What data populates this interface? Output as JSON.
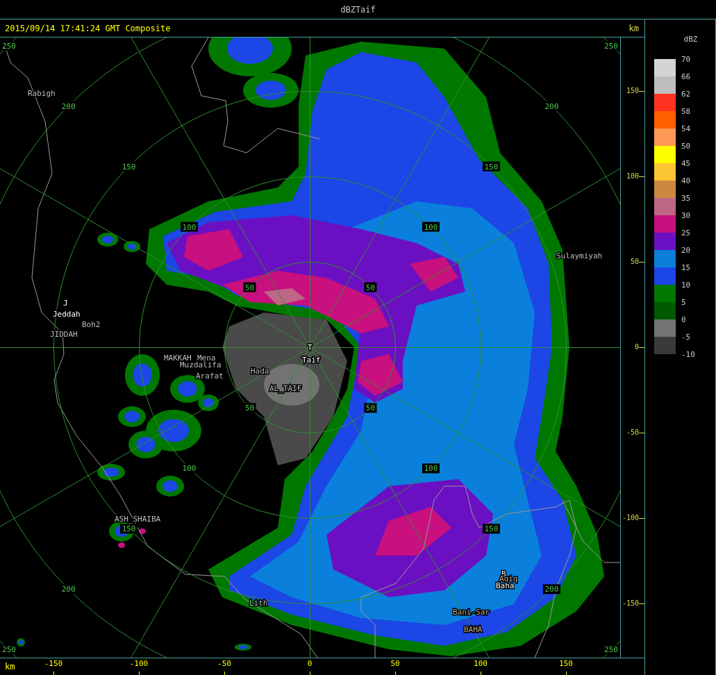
{
  "window": {
    "title": "dBZTaif"
  },
  "header": {
    "timestamp": "2015/09/14 17:41:24 GMT Composite",
    "unit": "km"
  },
  "map": {
    "range_rings": [
      {
        "labels": [
          "50",
          "50",
          "50",
          "50"
        ]
      },
      {
        "labels": [
          "100",
          "100",
          "100",
          "100"
        ]
      },
      {
        "labels": [
          "150",
          "150",
          "150",
          "150"
        ]
      },
      {
        "labels": [
          "200",
          "200",
          "200",
          "200"
        ]
      },
      {
        "labels": [
          "250",
          "250",
          "250",
          "250"
        ]
      }
    ],
    "places": [
      {
        "name": "Rabigh",
        "kind": "place"
      },
      {
        "name": "J",
        "kind": "station"
      },
      {
        "name": "Jeddah",
        "kind": "station"
      },
      {
        "name": "Boh2",
        "kind": "place"
      },
      {
        "name": "JIDDAH",
        "kind": "place"
      },
      {
        "name": "MAKKAH",
        "kind": "place"
      },
      {
        "name": "Mena",
        "kind": "place"
      },
      {
        "name": "Muzdalifa",
        "kind": "place"
      },
      {
        "name": "Arafat",
        "kind": "place"
      },
      {
        "name": "Hada",
        "kind": "place"
      },
      {
        "name": "AL_TAIF",
        "kind": "place"
      },
      {
        "name": "T",
        "kind": "station"
      },
      {
        "name": "Taif",
        "kind": "station"
      },
      {
        "name": "Sulaymiyah",
        "kind": "place"
      },
      {
        "name": "ASH_SHAIBA",
        "kind": "place"
      },
      {
        "name": "Lith",
        "kind": "place"
      },
      {
        "name": "Bani-Sar",
        "kind": "town"
      },
      {
        "name": "BAHA",
        "kind": "town"
      },
      {
        "name": "B",
        "kind": "station"
      },
      {
        "name": "Aqiq",
        "kind": "town"
      },
      {
        "name": "Baha",
        "kind": "station"
      }
    ]
  },
  "right_axis": {
    "ticks": [
      "150",
      "100",
      "50",
      "0",
      "-50",
      "-100",
      "-150"
    ]
  },
  "bottom_axis": {
    "unit": "km",
    "ticks": [
      "-150",
      "-100",
      "-50",
      "0",
      "50",
      "100",
      "150"
    ]
  },
  "legend": {
    "title": "dBZ",
    "bins": [
      {
        "label": "70",
        "color": "#d4d4d4"
      },
      {
        "label": "66",
        "color": "#bebebe"
      },
      {
        "label": "62",
        "color": "#ff3322"
      },
      {
        "label": "58",
        "color": "#ff5f00"
      },
      {
        "label": "54",
        "color": "#ff9955"
      },
      {
        "label": "50",
        "color": "#ffff00"
      },
      {
        "label": "45",
        "color": "#fac532"
      },
      {
        "label": "40",
        "color": "#cc8840"
      },
      {
        "label": "35",
        "color": "#bd6685"
      },
      {
        "label": "30",
        "color": "#c8107e"
      },
      {
        "label": "25",
        "color": "#6a10c2"
      },
      {
        "label": "20",
        "color": "#0a80dc"
      },
      {
        "label": "15",
        "color": "#1c46e6"
      },
      {
        "label": "10",
        "color": "#007800"
      },
      {
        "label": "5",
        "color": "#005a00"
      },
      {
        "label": "0",
        "color": "#737373"
      },
      {
        "label": "-5",
        "color": "#3a3a3a"
      }
    ],
    "bottom_label": "-10"
  }
}
